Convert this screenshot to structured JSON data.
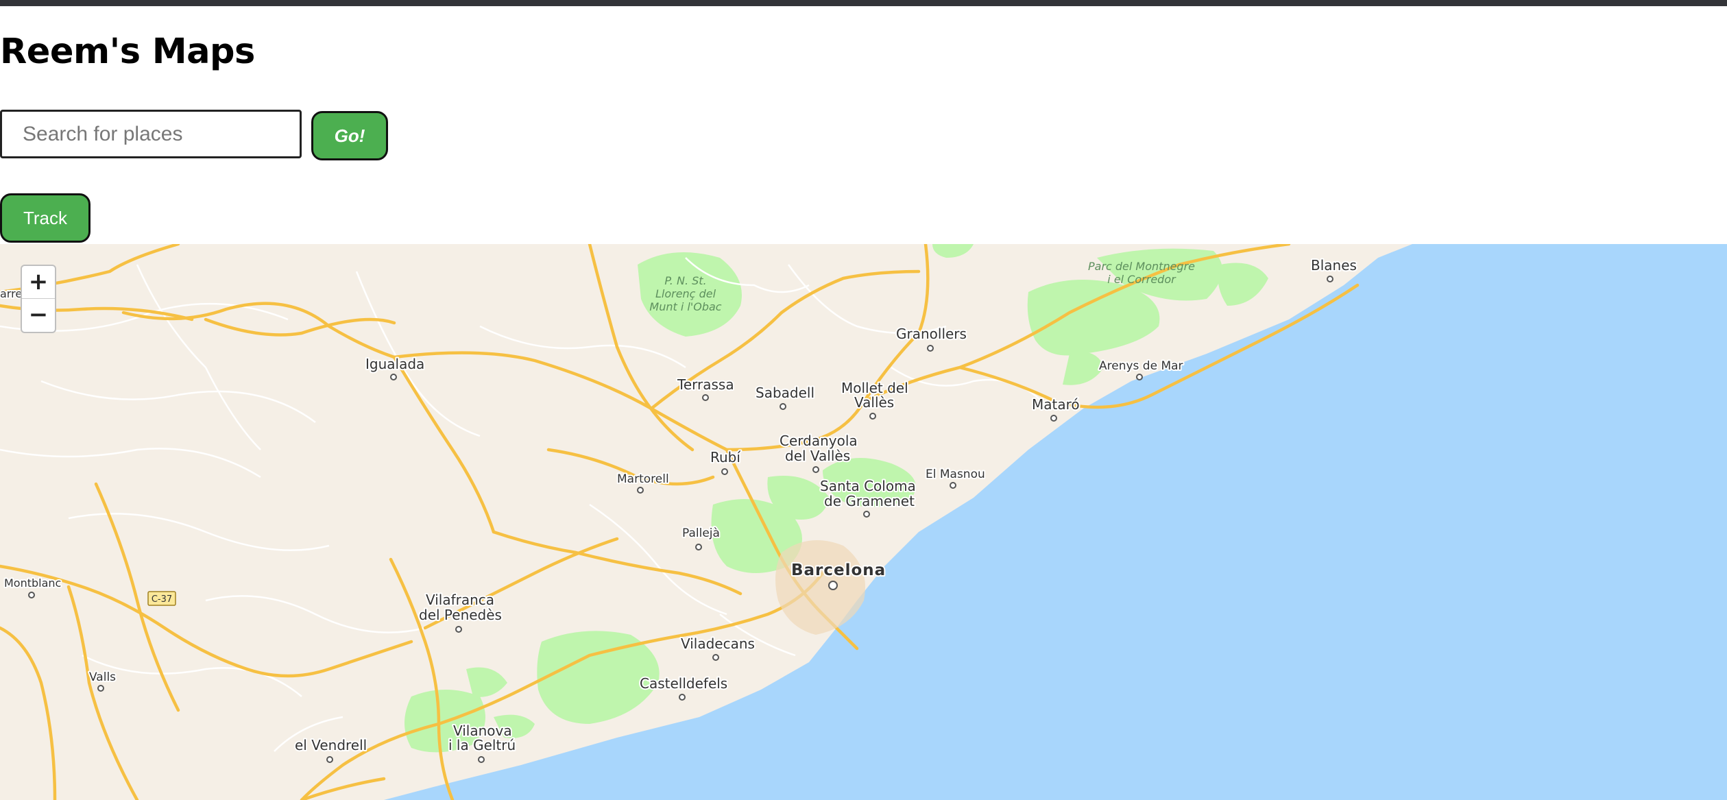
{
  "header": {
    "title": "Reem's Maps"
  },
  "search": {
    "placeholder": "Search for places",
    "value": "",
    "go_label": "Go!"
  },
  "track": {
    "label": "Track"
  },
  "map": {
    "zoom_in": "+",
    "zoom_out": "−",
    "colors": {
      "land": "#f5efe6",
      "sea": "#a8d6fc",
      "park": "#bff5ad",
      "major_road": "#f6c043",
      "minor_road": "#ffffff"
    },
    "places": {
      "blanes": "Blanes",
      "park_montnegre": [
        "Parc del Montnegre",
        "i el Corredor"
      ],
      "park_llorenc": [
        "P. N. St.",
        "Llorenç del",
        "Munt i l'Obac"
      ],
      "granollers": "Granollers",
      "igualada": "Igualada",
      "terrassa": "Terrassa",
      "sabadell": "Sabadell",
      "mollet": [
        "Mollet del",
        "Vallès"
      ],
      "arenys": "Arenys de Mar",
      "mataro": "Mataró",
      "cerdanyola": [
        "Cerdanyola",
        "del Vallès"
      ],
      "rubi": "Rubí",
      "martorell": "Martorell",
      "el_masnou": "El Masnou",
      "santa_coloma": [
        "Santa Coloma",
        "de Gramenet"
      ],
      "pallejà": "Pallejà",
      "barcelona": "Barcelona",
      "montblanc": "Montblanc",
      "c37": "C-37",
      "vilafranca": [
        "Vilafranca",
        "del Penedès"
      ],
      "viladecans": "Viladecans",
      "valls": "Valls",
      "castelldefels": "Castelldefels",
      "vilanova": [
        "Vilanova",
        "i la Geltrú"
      ],
      "el_vendrell": "el Vendrell",
      "edge": "arre"
    }
  }
}
